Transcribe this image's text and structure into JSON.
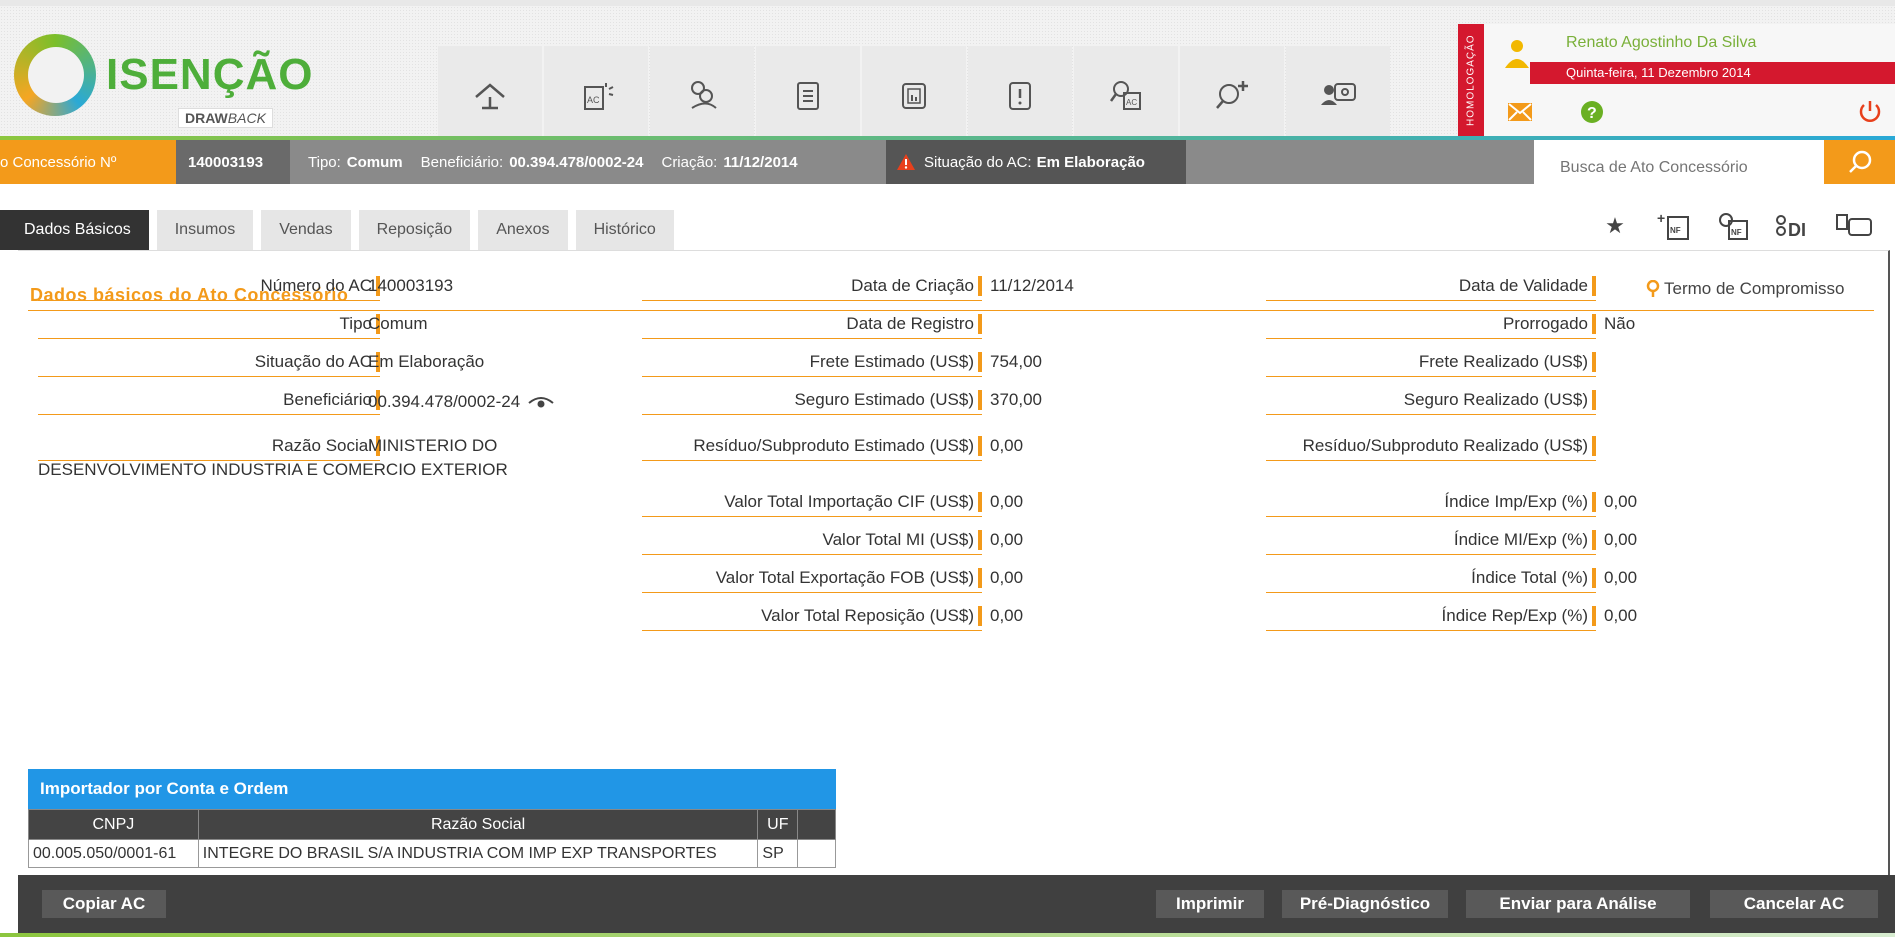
{
  "brand": {
    "title": "ISENÇÃO",
    "sub_bold": "DRAW",
    "sub_italic": "BACK"
  },
  "nav_icons": [
    "home-icon",
    "ac-sparkle-icon",
    "users-icon",
    "clipboard-icon",
    "document-chart-icon",
    "document-alert-icon",
    "search-ac-icon",
    "search-plus-icon",
    "user-settings-icon"
  ],
  "user": {
    "env_label": "HOMOLOGAÇÃO",
    "name": "Renato Agostinho Da Silva",
    "date": "Quinta-feira, 11 Dezembro 2014"
  },
  "infobar": {
    "ac_label": "o Concessório Nº",
    "ac_number": "140003193",
    "tipo_label": "Tipo:",
    "tipo_value": "Comum",
    "benef_label": "Beneficiário:",
    "benef_value": "00.394.478/0002-24",
    "criacao_label": "Criação:",
    "criacao_value": "11/12/2014",
    "situacao_label": "Situação do AC:",
    "situacao_value": "Em Elaboração"
  },
  "search": {
    "placeholder": "Busca de Ato Concessório"
  },
  "tabs": [
    "Dados Básicos",
    "Insumos",
    "Vendas",
    "Reposição",
    "Anexos",
    "Histórico"
  ],
  "section": {
    "title": "Dados básicos do Ato Concessório",
    "termo": "Termo de Compromisso"
  },
  "fields": {
    "numero_ac": {
      "label": "Número do AC",
      "value": "140003193"
    },
    "tipo": {
      "label": "Tipo",
      "value": "Comum"
    },
    "situacao": {
      "label": "Situação do AC",
      "value": "Em Elaboração"
    },
    "beneficiario": {
      "label": "Beneficiário",
      "value": "00.394.478/0002-24"
    },
    "razao_social": {
      "label": "Razão Social",
      "value_line1": "MINISTERIO DO",
      "value_line2": "DESENVOLVIMENTO INDUSTRIA E COMERCIO EXTERIOR"
    },
    "data_criacao": {
      "label": "Data de Criação",
      "value": "11/12/2014"
    },
    "data_registro": {
      "label": "Data de Registro",
      "value": ""
    },
    "frete_estimado": {
      "label": "Frete Estimado (US$)",
      "value": "754,00"
    },
    "seguro_estimado": {
      "label": "Seguro Estimado (US$)",
      "value": "370,00"
    },
    "residuo_estimado": {
      "label": "Resíduo/Subproduto Estimado (US$)",
      "value": "0,00"
    },
    "valor_importacao": {
      "label": "Valor Total Importação CIF (US$)",
      "value": "0,00"
    },
    "valor_mi": {
      "label": "Valor Total MI (US$)",
      "value": "0,00"
    },
    "valor_exportacao": {
      "label": "Valor Total Exportação FOB (US$)",
      "value": "0,00"
    },
    "valor_reposicao": {
      "label": "Valor Total Reposição (US$)",
      "value": "0,00"
    },
    "data_validade": {
      "label": "Data de Validade",
      "value": ""
    },
    "prorrogado": {
      "label": "Prorrogado",
      "value": "Não"
    },
    "frete_realizado": {
      "label": "Frete Realizado (US$)",
      "value": ""
    },
    "seguro_realizado": {
      "label": "Seguro Realizado (US$)",
      "value": ""
    },
    "residuo_realizado": {
      "label": "Resíduo/Subproduto Realizado (US$)",
      "value": ""
    },
    "indice_imp_exp": {
      "label": "Índice Imp/Exp (%)",
      "value": "0,00"
    },
    "indice_mi_exp": {
      "label": "Índice MI/Exp (%)",
      "value": "0,00"
    },
    "indice_total": {
      "label": "Índice Total (%)",
      "value": "0,00"
    },
    "indice_rep_exp": {
      "label": "Índice Rep/Exp (%)",
      "value": "0,00"
    }
  },
  "importador": {
    "title": "Importador por Conta e Ordem",
    "headers": [
      "CNPJ",
      "Razão Social",
      "UF"
    ],
    "rows": [
      [
        "00.005.050/0001-61",
        "INTEGRE DO BRASIL S/A INDUSTRIA COM IMP EXP TRANSPORTES",
        "SP"
      ]
    ]
  },
  "footer": {
    "copiar": "Copiar AC",
    "imprimir": "Imprimir",
    "pre_diagnostico": "Pré-Diagnóstico",
    "enviar": "Enviar para Análise",
    "cancelar": "Cancelar AC"
  },
  "colors": {
    "accent": "#f39a1a",
    "brand_green": "#4eae3a",
    "alert_red": "#d4182e",
    "table_blue": "#2196e6"
  }
}
